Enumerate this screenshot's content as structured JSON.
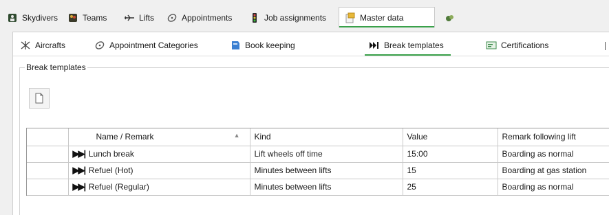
{
  "main_tabs": [
    {
      "label": "Skydivers",
      "icon": "skydiver-icon"
    },
    {
      "label": "Teams",
      "icon": "team-icon"
    },
    {
      "label": "Lifts",
      "icon": "plane-icon"
    },
    {
      "label": "Appointments",
      "icon": "appointment-icon"
    },
    {
      "label": "Job assignments",
      "icon": "traffic-light-icon"
    },
    {
      "label": "Master data",
      "icon": "master-data-icon"
    }
  ],
  "sub_tabs": [
    {
      "label": "Aircrafts",
      "icon": "aircraft-icon"
    },
    {
      "label": "Appointment Categories",
      "icon": "appointment-icon"
    },
    {
      "label": "Book keeping",
      "icon": "book-keeping-icon"
    },
    {
      "label": "Break templates",
      "icon": "skip-icon"
    },
    {
      "label": "Certifications",
      "icon": "certification-icon"
    }
  ],
  "group": {
    "title": "Break templates"
  },
  "grid": {
    "columns": [
      "Name / Remark",
      "Kind",
      "Value",
      "Remark following lift"
    ],
    "rows": [
      {
        "name": "Lunch break",
        "kind": "Lift wheels off time",
        "value": "15:00",
        "remark": "Boarding as normal"
      },
      {
        "name": "Refuel (Hot)",
        "kind": "Minutes between lifts",
        "value": "15",
        "remark": "Boarding at gas station"
      },
      {
        "name": "Refuel (Regular)",
        "kind": "Minutes between lifts",
        "value": "25",
        "remark": "Boarding as normal"
      }
    ]
  }
}
